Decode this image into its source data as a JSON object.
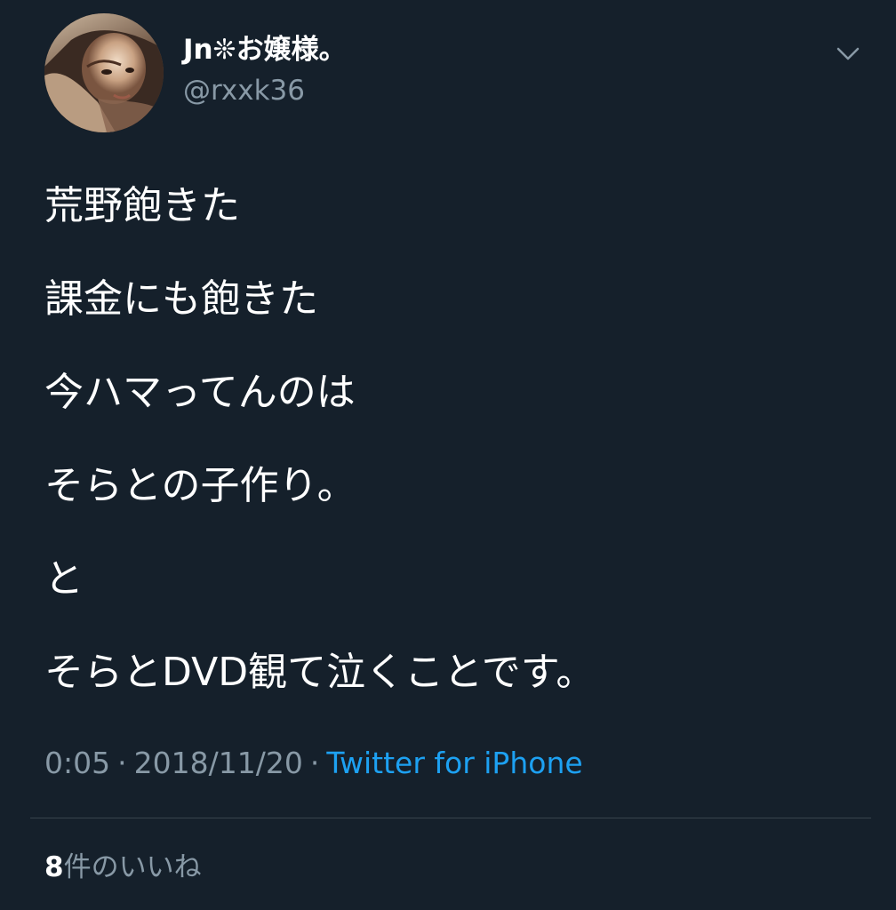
{
  "user": {
    "display_name": "Jn❊お嬢様。",
    "handle": "@rxxk36"
  },
  "tweet": {
    "lines": [
      "荒野飽きた",
      "課金にも飽きた",
      "今ハマってんのは",
      "そらとの子作り。",
      "と",
      "そらとDVD観て泣くことです。"
    ],
    "time": "0:05",
    "separator": "·",
    "date": "2018/11/20",
    "source": "Twitter for iPhone"
  },
  "likes": {
    "count": "8",
    "label": "件のいいね"
  },
  "icons": {
    "menu": "chevron-down-icon",
    "avatar": "profile-avatar"
  },
  "colors": {
    "background": "#15202b",
    "text": "#ffffff",
    "secondary_text": "#8899a6",
    "link": "#1da1f2",
    "divider": "#38444d"
  }
}
